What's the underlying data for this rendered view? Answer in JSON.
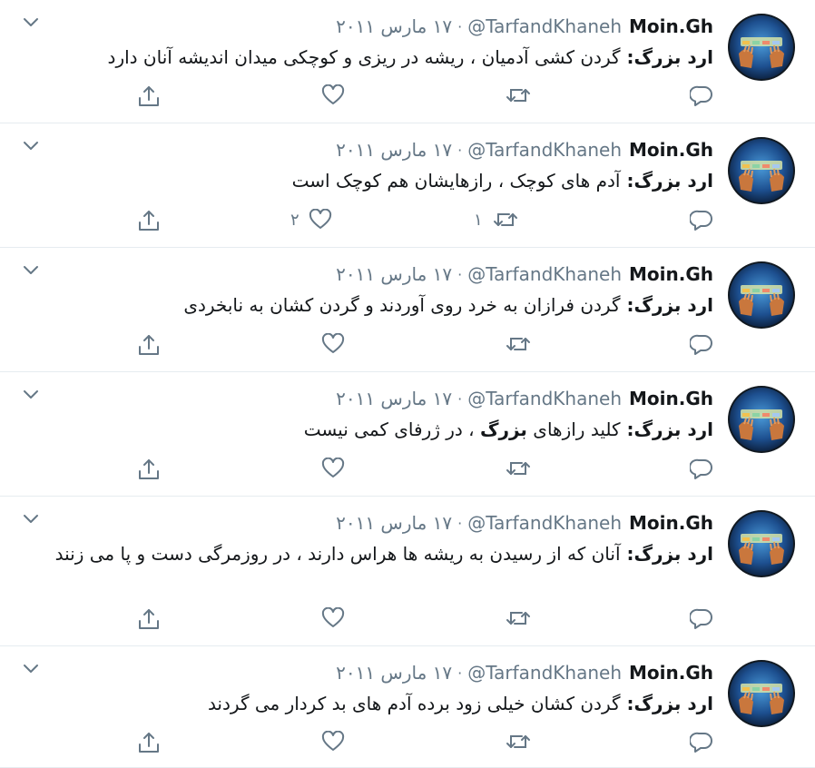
{
  "colors": {
    "text": "#14171a",
    "secondary": "#657786",
    "border": "#e6ecf0",
    "icon": "#657786"
  },
  "icons": {
    "more": "chevron-down-icon",
    "reply": "reply-icon",
    "retweet": "retweet-icon",
    "like": "heart-icon",
    "share": "share-icon"
  },
  "tweets": [
    {
      "name": "Moin.Gh",
      "handle": "@TarfandKhaneh",
      "date": "۱۷ مارس ۲۰۱۱",
      "body": [
        {
          "text": "ارد بزرگ: ",
          "bold": true
        },
        {
          "text": "گردن کشی آدمیان ، ریشه در ریزی و کوچکی میدان اندیشه آنان دارد",
          "bold": false
        }
      ],
      "retweets": "",
      "likes": ""
    },
    {
      "name": "Moin.Gh",
      "handle": "@TarfandKhaneh",
      "date": "۱۷ مارس ۲۰۱۱",
      "body": [
        {
          "text": "ارد بزرگ: ",
          "bold": true
        },
        {
          "text": "آدم های کوچک ، رازهایشان هم کوچک است",
          "bold": false
        }
      ],
      "retweets": "۱",
      "likes": "۲"
    },
    {
      "name": "Moin.Gh",
      "handle": "@TarfandKhaneh",
      "date": "۱۷ مارس ۲۰۱۱",
      "body": [
        {
          "text": "ارد بزرگ: ",
          "bold": true
        },
        {
          "text": "گردن فرازان به خرد روی آوردند و گردن کشان به نابخردی",
          "bold": false
        }
      ],
      "retweets": "",
      "likes": ""
    },
    {
      "name": "Moin.Gh",
      "handle": "@TarfandKhaneh",
      "date": "۱۷ مارس ۲۰۱۱",
      "body": [
        {
          "text": "ارد بزرگ: ",
          "bold": true
        },
        {
          "text": "کلید رازهای ",
          "bold": false
        },
        {
          "text": "بزرگ",
          "bold": true
        },
        {
          "text": " ، در ژرفای کمی نیست",
          "bold": false
        }
      ],
      "retweets": "",
      "likes": ""
    },
    {
      "name": "Moin.Gh",
      "handle": "@TarfandKhaneh",
      "date": "۱۷ مارس ۲۰۱۱",
      "body": [
        {
          "text": "ارد بزرگ: ",
          "bold": true
        },
        {
          "text": "آنان که از رسیدن به ریشه ها هراس دارند ، در روزمرگی دست و پا می زنند",
          "bold": false
        }
      ],
      "retweets": "",
      "likes": ""
    },
    {
      "name": "Moin.Gh",
      "handle": "@TarfandKhaneh",
      "date": "۱۷ مارس ۲۰۱۱",
      "body": [
        {
          "text": "ارد بزرگ: ",
          "bold": true
        },
        {
          "text": "گردن کشان خیلی زود برده آدم های بد کردار می گردند",
          "bold": false
        }
      ],
      "retweets": "",
      "likes": ""
    }
  ]
}
